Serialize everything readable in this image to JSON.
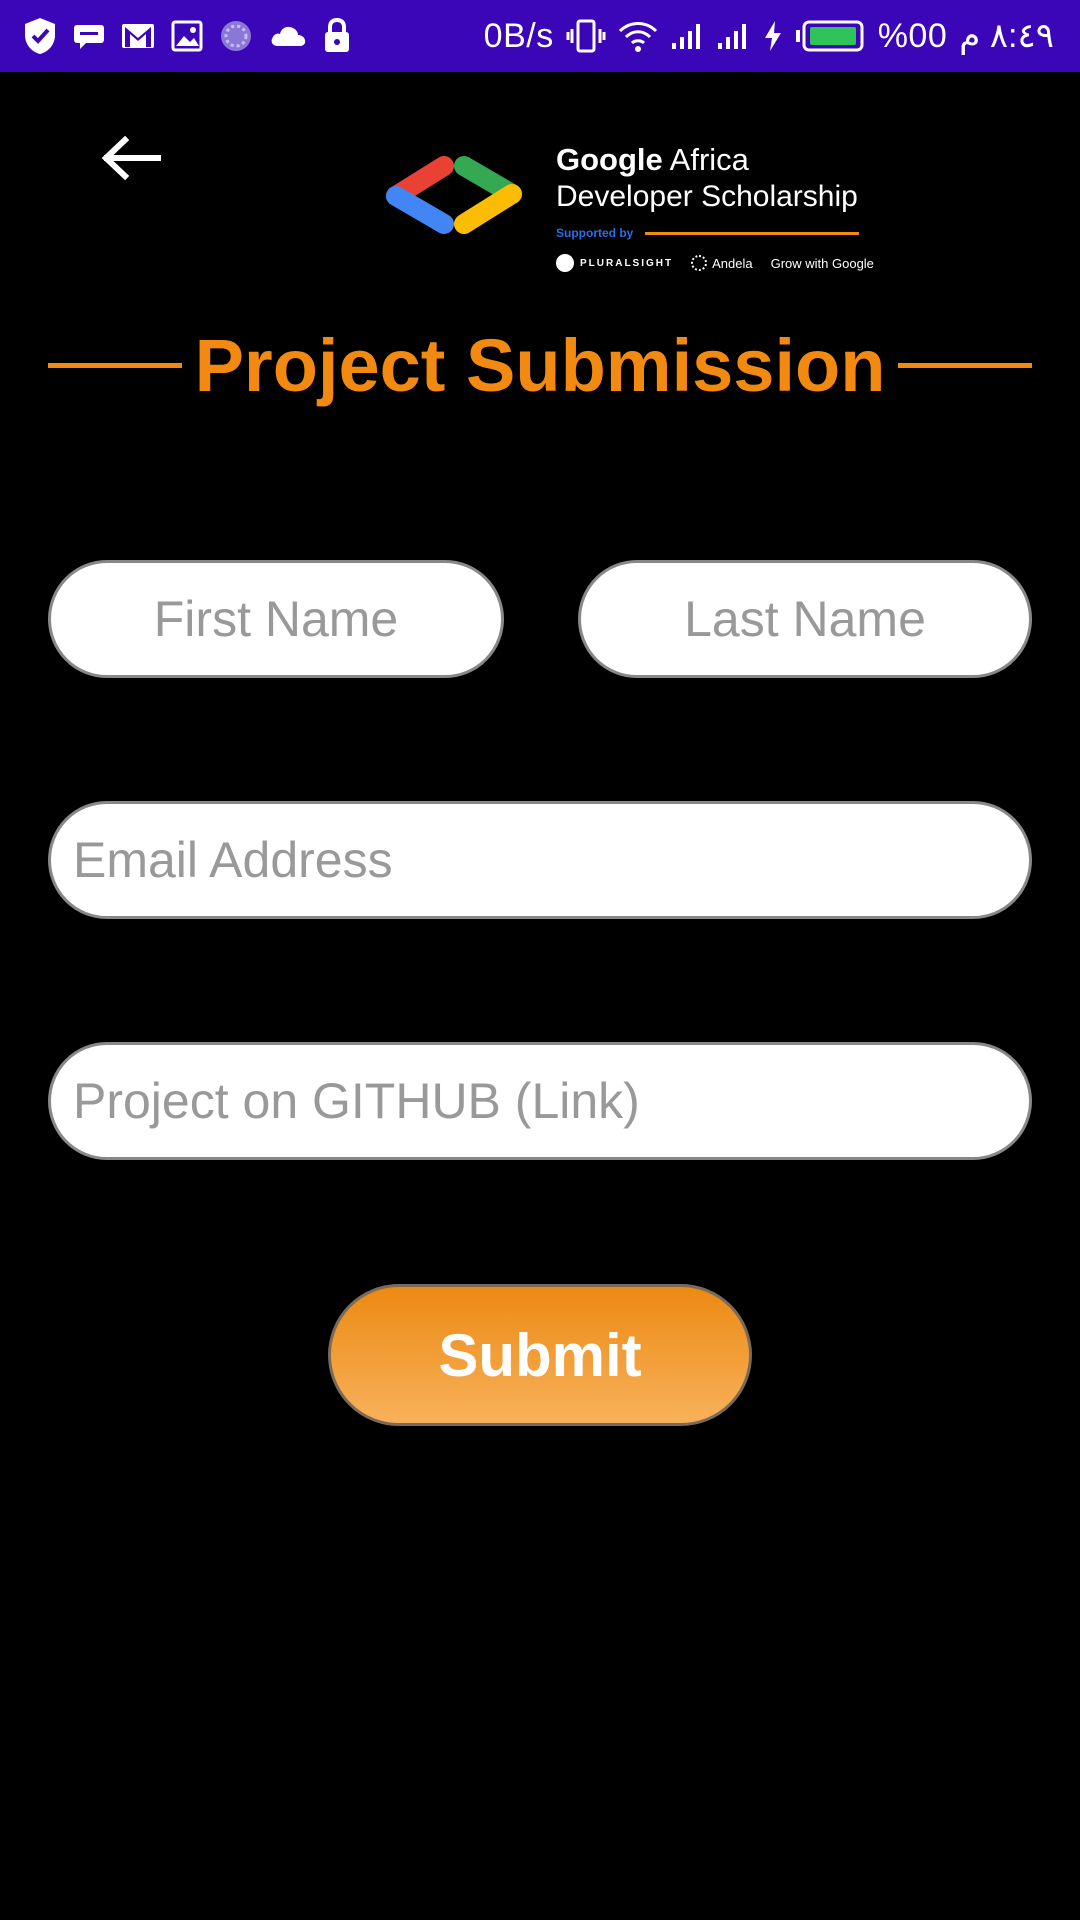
{
  "status_bar": {
    "net_speed": "0B/s",
    "battery_percent": "%00",
    "time": "٨:٤٩ م",
    "icons": [
      "shield-icon",
      "message-icon",
      "gmail-icon",
      "image-icon",
      "sync-icon",
      "cloud-icon",
      "lock-icon",
      "vibrate-icon",
      "wifi-icon",
      "signal-icon",
      "signal-icon",
      "charging-icon",
      "battery-icon"
    ],
    "bar_color": "#3a06b8"
  },
  "header": {
    "back_icon": "arrow-left-icon",
    "logo": {
      "line1_bold": "Google",
      "line1_rest": " Africa",
      "line2": "Developer Scholarship",
      "supported_by": "Supported by",
      "partners": [
        "PLURALSIGHT",
        "Andela",
        "Grow with Google"
      ]
    }
  },
  "page": {
    "title": "Project Submission",
    "accent_color": "#f28a12"
  },
  "form": {
    "first_name_placeholder": "First Name",
    "last_name_placeholder": "Last Name",
    "email_placeholder": "Email Address",
    "github_placeholder": "Project on GITHUB (Link)",
    "submit_label": "Submit"
  }
}
